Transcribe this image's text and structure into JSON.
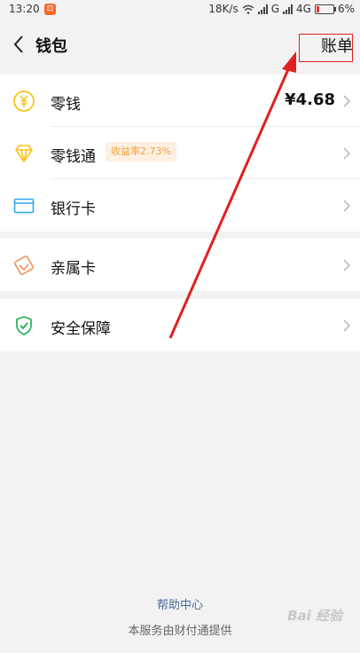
{
  "status_bar": {
    "time": "13:20",
    "notification": "⊡",
    "net_speed": "18K/s",
    "network_g": "G",
    "network_4g": "4G",
    "battery": "6%"
  },
  "header": {
    "back_icon": "chevron-left-icon",
    "title": "钱包",
    "bill_label": "账单"
  },
  "wallet": {
    "items": [
      {
        "label": "零钱",
        "value": "¥4.68",
        "icon": "yuan-coin-icon",
        "color": "#f5c518"
      },
      {
        "label": "零钱通",
        "badge": "收益率2.73%",
        "icon": "diamond-icon",
        "color": "#f5c518"
      },
      {
        "label": "银行卡",
        "icon": "bank-card-icon",
        "color": "#2fa8e8"
      }
    ],
    "family_card": {
      "label": "亲属卡",
      "icon": "family-card-icon",
      "color": "#f0925a"
    },
    "security": {
      "label": "安全保障",
      "icon": "shield-check-icon",
      "color": "#1aad52"
    }
  },
  "footer": {
    "help": "帮助中心",
    "provider": "本服务由财付通提供",
    "watermark": "Bai 经验"
  },
  "annotation": {
    "color": "#e02020"
  }
}
